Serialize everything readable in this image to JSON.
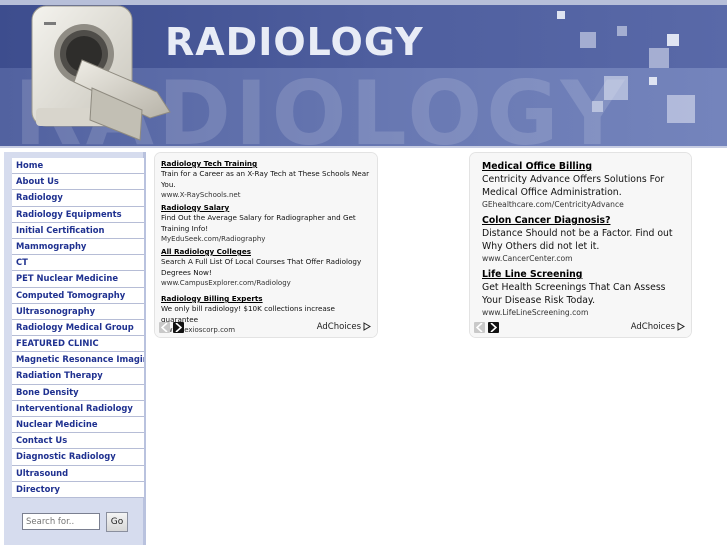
{
  "header": {
    "title": "RADIOLOGY",
    "watermark": "RADIOLOGY"
  },
  "colors": {
    "header_blue": "#4a5a98",
    "nav_text": "#1f3190",
    "sidebar_bg": "#d6dcee"
  },
  "nav": {
    "items": [
      "Home",
      "About Us",
      "Radiology",
      "Radiology Equipments",
      "Initial Certification",
      "Mammography",
      "CT",
      "PET Nuclear Medicine",
      "Computed Tomography",
      "Ultrasonography",
      "Radiology Medical Group",
      "FEATURED CLINIC",
      "Magnetic Resonance Imaging",
      "Radiation Therapy",
      "Bone Density",
      "Interventional Radiology",
      "Nuclear Medicine",
      "Contact Us",
      "Diagnostic Radiology",
      "Ultrasound",
      "Directory"
    ]
  },
  "search": {
    "placeholder": "Search for..",
    "go_label": "Go"
  },
  "ads_left": {
    "items": [
      {
        "title": "Radiology Tech Training",
        "desc": "Train for a Career as an X-Ray Tech at These Schools Near You.",
        "url": "www.X-RaySchools.net"
      },
      {
        "title": "Radiology Salary",
        "desc": "Find Out the Average Salary for Radiographer and Get Training Info!",
        "url": "MyEduSeek.com/Radiography"
      },
      {
        "title": "All Radiology Colleges",
        "desc": "Search A Full List Of Local Courses That Offer Radiology Degrees Now!",
        "url": "www.CampusExplorer.com/Radiology"
      },
      {
        "title": "Radiology Billing Experts",
        "desc": "We only bill radiology! $10K collections increase guarantee",
        "url": "www.dexioscorp.com"
      }
    ],
    "adchoices": "AdChoices"
  },
  "ads_right": {
    "items": [
      {
        "title": "Medical Office Billing",
        "desc": "Centricity Advance Offers Solutions For Medical Office Administration.",
        "url": "GEhealthcare.com/CentricityAdvance"
      },
      {
        "title": "Colon Cancer Diagnosis?",
        "desc": "Distance Should not be a Factor. Find out Why Others did not let it.",
        "url": "www.CancerCenter.com"
      },
      {
        "title": "Life Line Screening",
        "desc": "Get Health Screenings That Can Assess Your Disease Risk Today.",
        "url": "www.LifeLineScreening.com"
      }
    ],
    "adchoices": "AdChoices"
  },
  "icons": {
    "prev": "chevron-left-icon",
    "next": "chevron-right-icon",
    "adchoices": "adchoices-triangle-icon"
  }
}
